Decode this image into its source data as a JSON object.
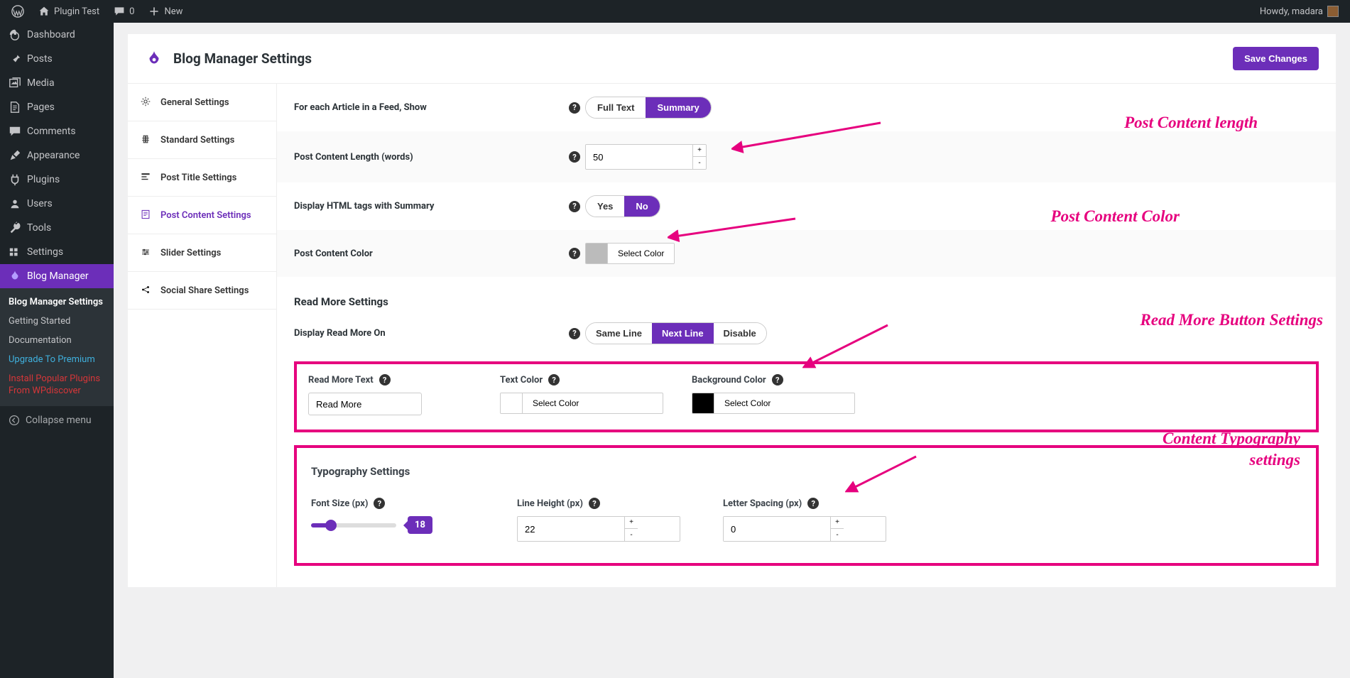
{
  "adminbar": {
    "site": "Plugin Test",
    "comments": "0",
    "new": "New",
    "howdy_prefix": "Howdy, ",
    "user": "madara"
  },
  "sidebar": {
    "items": [
      {
        "icon": "dashboard",
        "label": "Dashboard"
      },
      {
        "icon": "pin",
        "label": "Posts"
      },
      {
        "icon": "media",
        "label": "Media"
      },
      {
        "icon": "page",
        "label": "Pages"
      },
      {
        "icon": "comment",
        "label": "Comments"
      },
      {
        "icon": "appearance",
        "label": "Appearance"
      },
      {
        "icon": "plugin",
        "label": "Plugins"
      },
      {
        "icon": "users",
        "label": "Users"
      },
      {
        "icon": "tools",
        "label": "Tools"
      },
      {
        "icon": "settings",
        "label": "Settings"
      },
      {
        "icon": "flame",
        "label": "Blog Manager",
        "current": true
      }
    ],
    "submenu": {
      "items": [
        {
          "label": "Blog Manager Settings",
          "cls": "active"
        },
        {
          "label": "Getting Started"
        },
        {
          "label": "Documentation"
        },
        {
          "label": "Upgrade To Premium",
          "cls": "premium"
        },
        {
          "label": "Install Popular Plugins From WPdiscover",
          "cls": "install"
        }
      ]
    },
    "collapse": "Collapse menu"
  },
  "page_title": "Blog Manager Settings",
  "save_button": "Save Changes",
  "tabs": [
    {
      "icon": "gear",
      "label": "General Settings"
    },
    {
      "icon": "standard",
      "label": "Standard Settings"
    },
    {
      "icon": "title",
      "label": "Post Title Settings"
    },
    {
      "icon": "content",
      "label": "Post Content Settings",
      "active": true
    },
    {
      "icon": "slider",
      "label": "Slider Settings"
    },
    {
      "icon": "share",
      "label": "Social Share Settings"
    }
  ],
  "settings": {
    "feed_show": {
      "label": "For each Article in a Feed, Show",
      "opts": [
        "Full Text",
        "Summary"
      ],
      "selected": 1
    },
    "content_length": {
      "label": "Post Content Length (words)",
      "value": "50"
    },
    "html_tags": {
      "label": "Display HTML tags with Summary",
      "opts": [
        "Yes",
        "No"
      ],
      "selected": 1
    },
    "content_color": {
      "label": "Post Content Color",
      "button": "Select Color"
    },
    "read_more_heading": "Read More Settings",
    "display_read_more": {
      "label": "Display Read More On",
      "opts": [
        "Same Line",
        "Next Line",
        "Disable"
      ],
      "selected": 1
    },
    "read_more_text": {
      "label": "Read More Text",
      "value": "Read More"
    },
    "text_color": {
      "label": "Text Color",
      "button": "Select Color"
    },
    "bg_color": {
      "label": "Background Color",
      "button": "Select Color"
    },
    "typography_heading": "Typography Settings",
    "font_size": {
      "label": "Font Size (px)",
      "value": "18"
    },
    "line_height": {
      "label": "Line Height (px)",
      "value": "22"
    },
    "letter_spacing": {
      "label": "Letter Spacing (px)",
      "value": "0"
    }
  },
  "annotations": {
    "a1": "Post Content length",
    "a2": "Post Content Color",
    "a3": "Read More Button Settings",
    "a4": "Content Typography settings"
  }
}
